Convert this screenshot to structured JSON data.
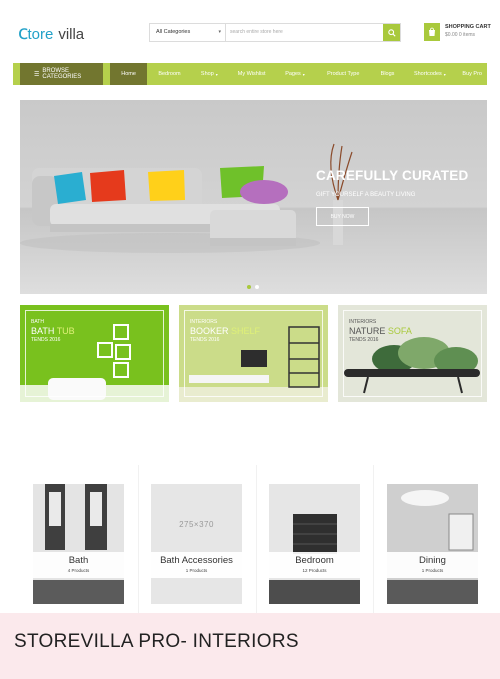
{
  "header": {
    "logo_glyph": "c",
    "logo_part1": "tore",
    "logo_part2": "villa",
    "search": {
      "category": "All Categories",
      "placeholder": "search entire store here"
    },
    "cart": {
      "title": "SHOPPING CART",
      "summary": "$0.00 0 items"
    }
  },
  "nav": {
    "browse_label": "BROWSE CATEGORIES",
    "items": [
      {
        "label": "Home"
      },
      {
        "label": "Bedroom"
      },
      {
        "label": "Shop"
      },
      {
        "label": "My Wishlist"
      },
      {
        "label": "Pages"
      },
      {
        "label": "Product Type"
      },
      {
        "label": "Blogs"
      },
      {
        "label": "Shortcodes"
      },
      {
        "label": "Buy Pro"
      }
    ]
  },
  "hero": {
    "title": "CAREFULLY CURATED",
    "subtitle": "GIFT YOURSELF A BEAUTY LIVING",
    "button": "BUY NOW"
  },
  "banners": [
    {
      "small": "BATH",
      "big_a": "BATH",
      "big_b": "TUB",
      "date": "TENDS 2016"
    },
    {
      "small": "INTERIORS",
      "big_a": "BOOKER",
      "big_b": "SHELF",
      "date": "TENDS 2016"
    },
    {
      "small": "INTERIORS",
      "big_a": "NATURE",
      "big_b": "SOFA",
      "date": "TENDS 2016"
    }
  ],
  "categories": [
    {
      "name": "Bath",
      "count": "4 Products"
    },
    {
      "name": "Bath Accessories",
      "count": "1 Products",
      "placeholder": "275×370"
    },
    {
      "name": "Bedroom",
      "count": "12 Products"
    },
    {
      "name": "Dining",
      "count": "1 Products"
    }
  ],
  "footer": {
    "text": "STOREVILLA PRO- INTERIORS"
  },
  "colors": {
    "accent": "#a9c93c",
    "nav_dark": "#72762f",
    "brand_blue": "#22a1c8",
    "footer_bg": "#fbe9ec"
  }
}
